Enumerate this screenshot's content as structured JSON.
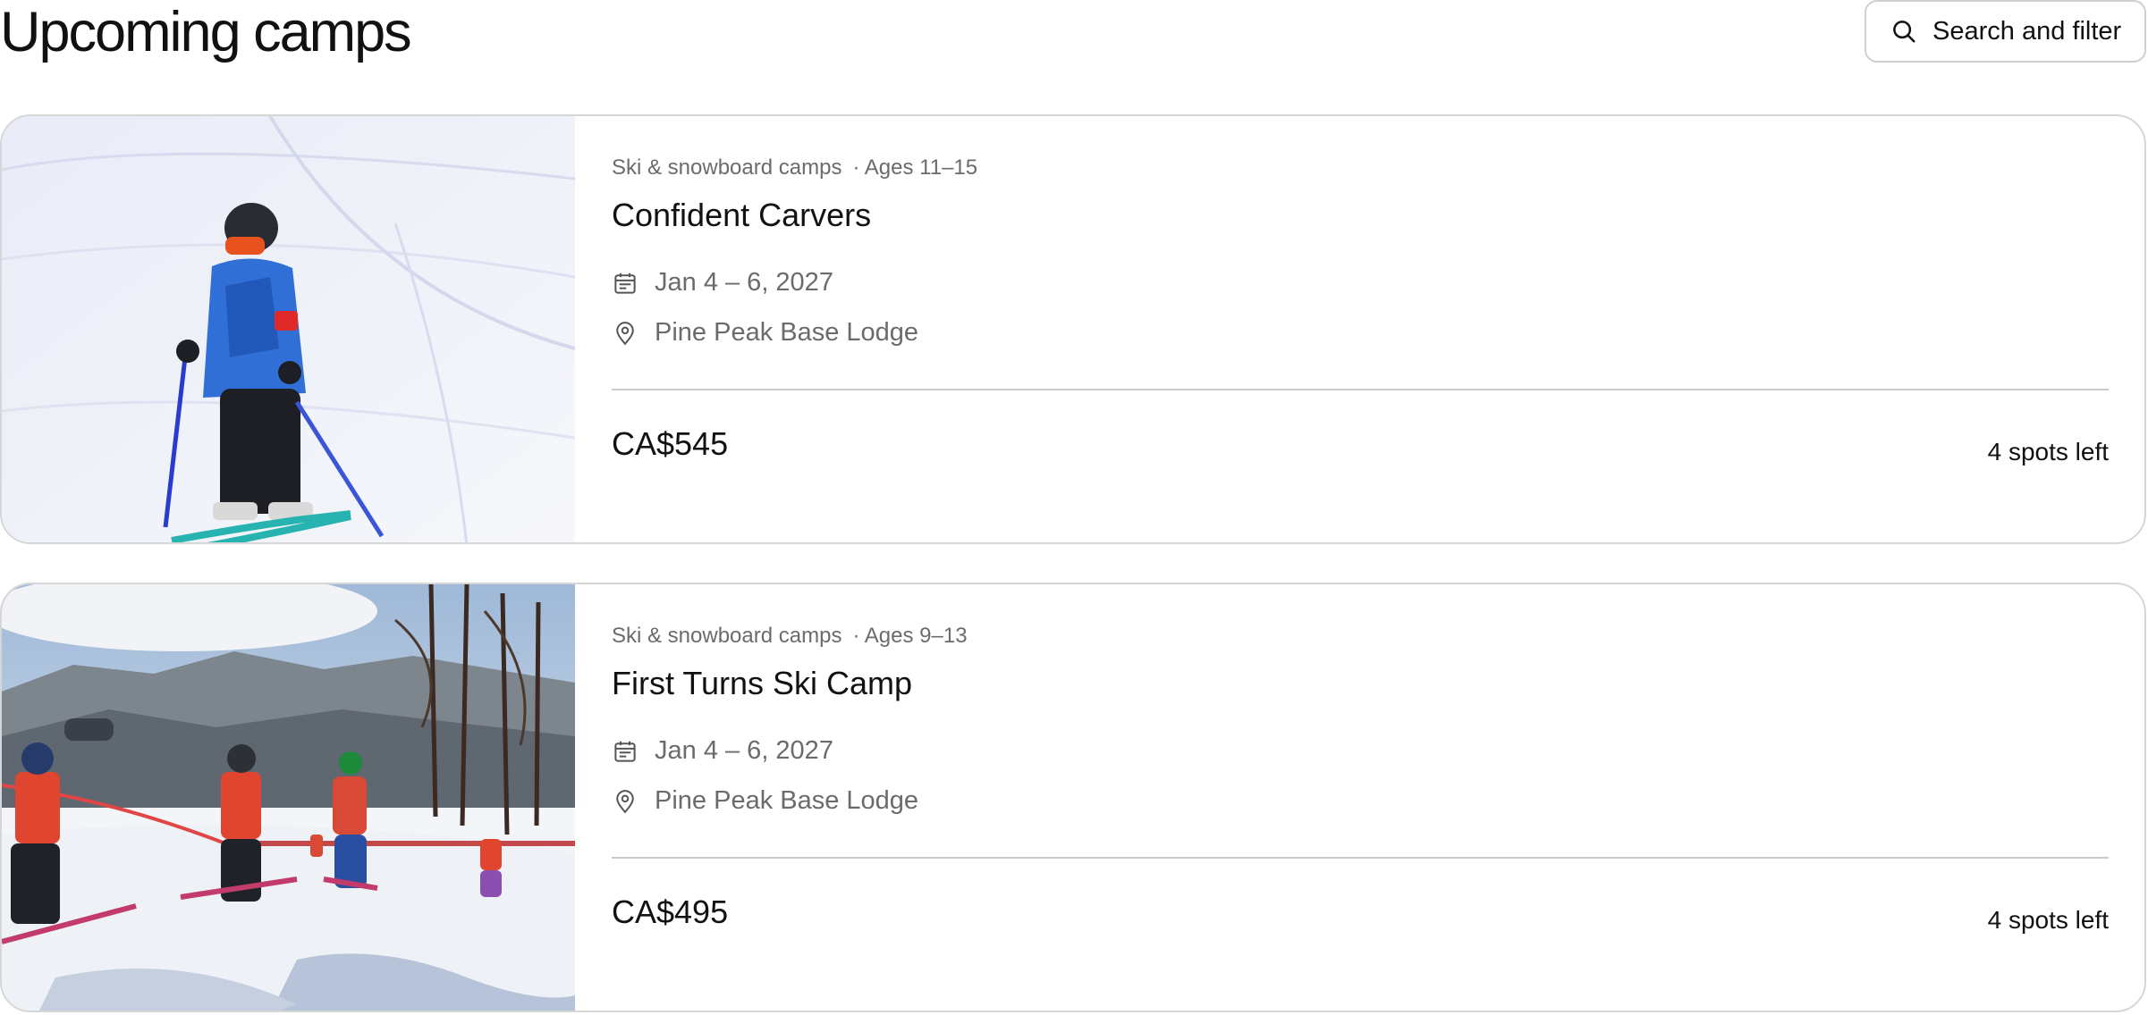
{
  "page": {
    "title": "Upcoming camps",
    "search_button_label": "Search and filter"
  },
  "camps": [
    {
      "category": "Ski & snowboard camps",
      "ages": "· Ages 11–15",
      "title": "Confident Carvers",
      "dates": "Jan 4 – 6, 2027",
      "location": "Pine Peak Base Lodge",
      "price": "CA$545",
      "spots": "4 spots left",
      "image_icon": "skier-photo"
    },
    {
      "category": "Ski & snowboard camps",
      "ages": "· Ages 9–13",
      "title": "First Turns Ski Camp",
      "dates": "Jan 4 – 6, 2027",
      "location": "Pine Peak Base Lodge",
      "price": "CA$495",
      "spots": "4 spots left",
      "image_icon": "ski-group-photo"
    }
  ],
  "colors": {
    "text": "#111111",
    "muted": "#6b6b6b",
    "border": "#d6d6d6",
    "divider": "#c9c9c9"
  }
}
